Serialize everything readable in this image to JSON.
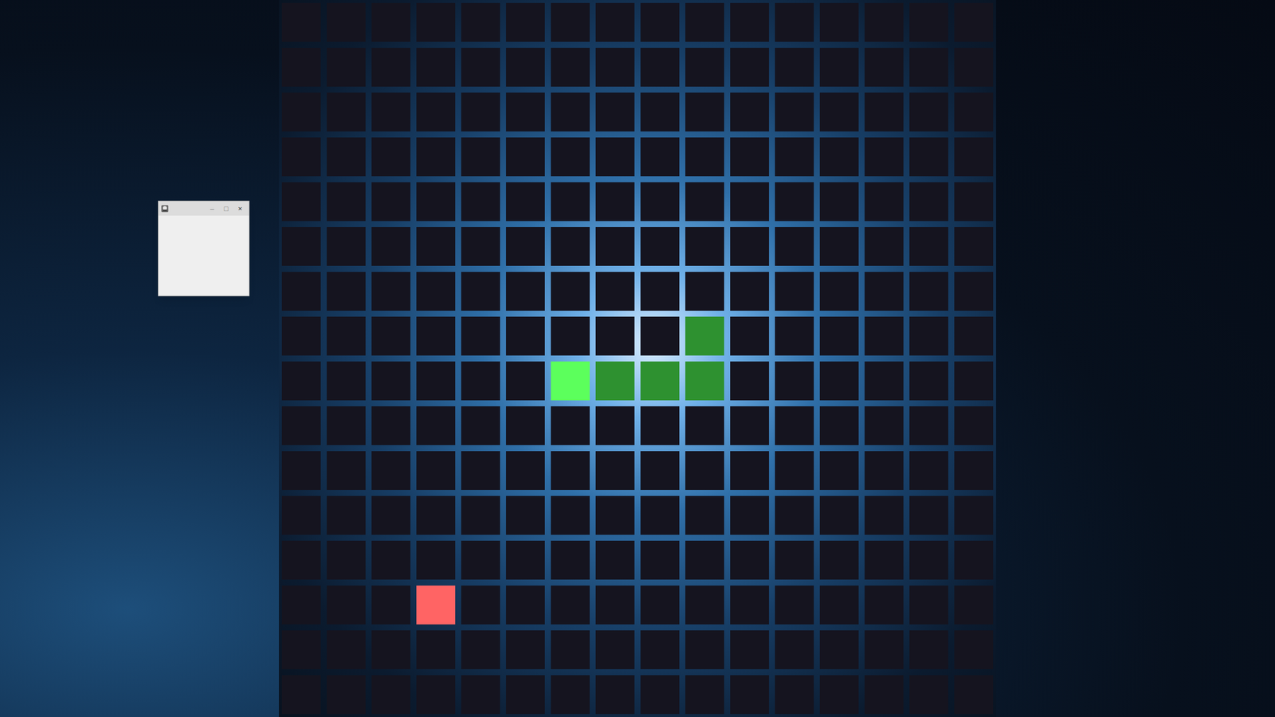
{
  "window": {
    "title": "",
    "buttons": [
      "–",
      "□",
      "×"
    ]
  },
  "board": {
    "columns": 16,
    "rows": 16,
    "snake": [
      {
        "col": 6,
        "row": 8,
        "kind": "head",
        "color": "#5cff5c"
      },
      {
        "col": 7,
        "row": 8,
        "kind": "body",
        "color": "#2e9130"
      },
      {
        "col": 8,
        "row": 8,
        "kind": "body",
        "color": "#2e9130"
      },
      {
        "col": 9,
        "row": 8,
        "kind": "body",
        "color": "#2e9130"
      },
      {
        "col": 9,
        "row": 7,
        "kind": "body",
        "color": "#2e9130"
      }
    ],
    "food": {
      "col": 3,
      "row": 13,
      "color": "#ff6464"
    }
  }
}
